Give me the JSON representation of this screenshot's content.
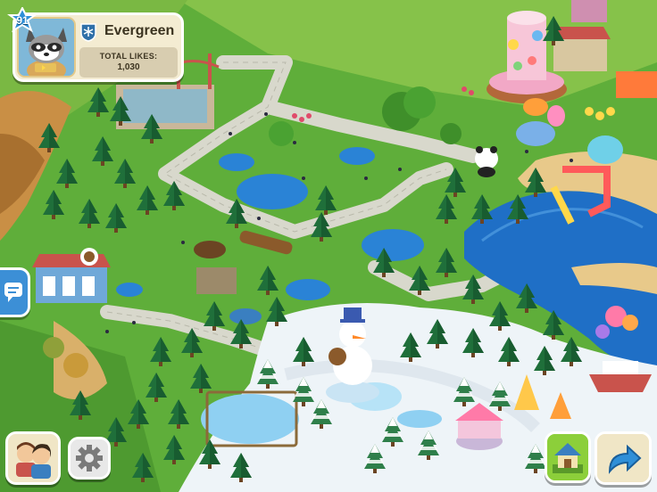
{
  "profile": {
    "level": "91",
    "zoo_name": "Evergreen",
    "likes_label": "TOTAL LIKES:",
    "likes_value": "1,030",
    "avatar_icon": "raccoon-avatar",
    "emblem_icon": "snowflake-shield-icon"
  },
  "hud": {
    "chat_icon": "chat-bubble-icon",
    "friends_icon": "friends-avatars-icon",
    "settings_icon": "gear-icon",
    "map_icon": "house-map-icon",
    "share_icon": "share-arrow-icon"
  },
  "colors": {
    "grass": "#5fae3a",
    "path": "#dcdcd0",
    "water": "#1f6fc6",
    "snow": "#eef4f8",
    "sand": "#e8c98a",
    "badge_blue": "#2f8fd8",
    "accent_green": "#8ccf3a"
  }
}
